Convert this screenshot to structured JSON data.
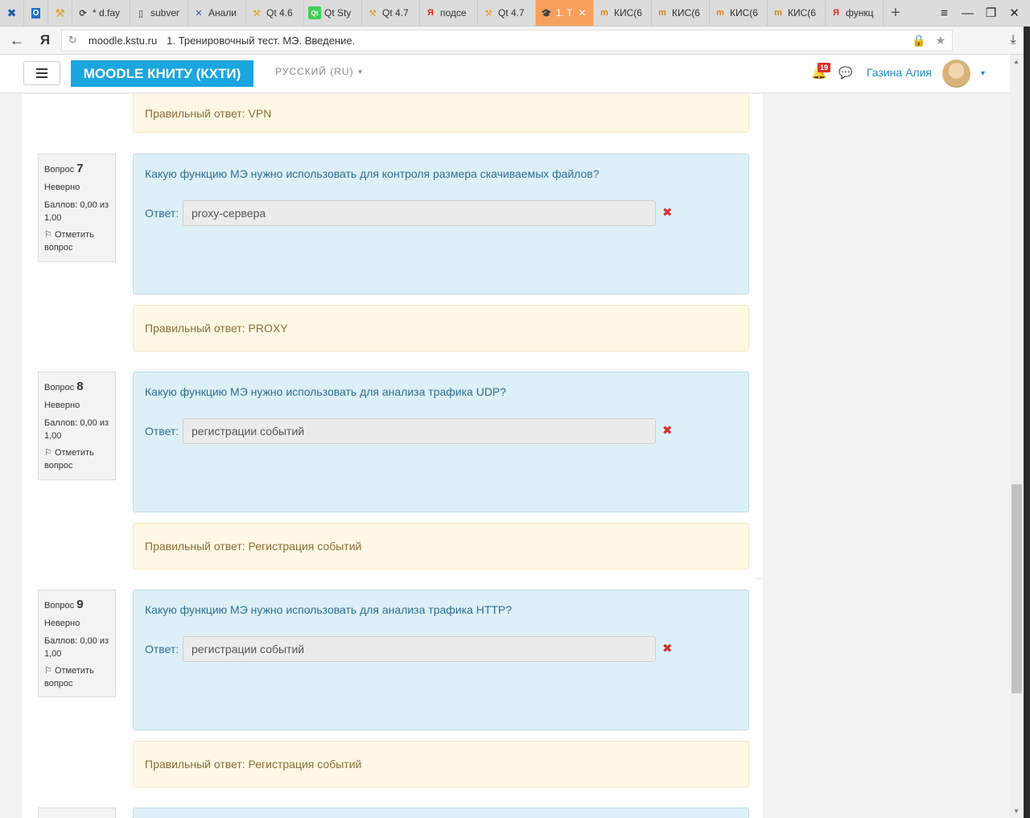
{
  "browser": {
    "tabs": [
      {
        "label": "* d.fay",
        "favicon": "reload-icon"
      },
      {
        "label": "subver",
        "favicon": "doc-icon"
      },
      {
        "label": "Анали",
        "favicon": "x-icon"
      },
      {
        "label": "Qt 4.6",
        "favicon": "moodle-icon"
      },
      {
        "label": "Qt Sty",
        "favicon": "qt-icon"
      },
      {
        "label": "Qt 4.7",
        "favicon": "moodle-icon"
      },
      {
        "label": "подсе",
        "favicon": "yandex-icon"
      },
      {
        "label": "Qt 4.7",
        "favicon": "moodle-icon"
      },
      {
        "label": "1. T",
        "favicon": "moodle-icon",
        "active": true
      },
      {
        "label": "КИС(6",
        "favicon": "moodle-m-icon"
      },
      {
        "label": "КИС(6",
        "favicon": "moodle-m-icon"
      },
      {
        "label": "КИС(6",
        "favicon": "moodle-m-icon"
      },
      {
        "label": "КИС(6",
        "favicon": "moodle-m-icon"
      },
      {
        "label": "функц",
        "favicon": "yandex-icon"
      }
    ],
    "active_tab_color": "#f7a05c",
    "address": {
      "domain": "moodle.kstu.ru",
      "title": "1. Тренировочный тест. МЭ. Введение."
    },
    "yandex_glyph": "Я"
  },
  "navbar": {
    "brand": "MOODLE КНИТУ (КХТИ)",
    "brand_color": "#1ba6df",
    "language": "РУССКИЙ (RU)",
    "notifications_count": "19",
    "username": "Газина Алия"
  },
  "previous_feedback": "Правильный ответ: VPN",
  "questions": [
    {
      "label": "Вопрос",
      "number": "7",
      "state": "Неверно",
      "grade": "Баллов: 0,00 из 1,00",
      "flag": "Отметить вопрос",
      "text": "Какую функцию МЭ нужно использовать для контроля размера скачиваемых файлов?",
      "answer_label": "Ответ:",
      "answer": "proxy-сервера",
      "feedback": "Правильный ответ: PROXY"
    },
    {
      "label": "Вопрос",
      "number": "8",
      "state": "Неверно",
      "grade": "Баллов: 0,00 из 1,00",
      "flag": "Отметить вопрос",
      "text": "Какую функцию МЭ нужно использовать для анализа трафика UDP?",
      "answer_label": "Ответ:",
      "answer": "регистрации событий",
      "feedback": "Правильный ответ: Регистрация событий"
    },
    {
      "label": "Вопрос",
      "number": "9",
      "state": "Неверно",
      "grade": "Баллов: 0,00 из 1,00",
      "flag": "Отметить вопрос",
      "text": "Какую функцию МЭ нужно использовать для анализа трафика HTTP?",
      "answer_label": "Ответ:",
      "answer": "регистрации событий",
      "feedback": "Правильный ответ: Регистрация событий"
    }
  ],
  "colors": {
    "question_bg": "#def0f7",
    "feedback_bg": "#fcf8e3",
    "wrong_mark": "#d9302c",
    "question_text": "#2b6f93"
  }
}
